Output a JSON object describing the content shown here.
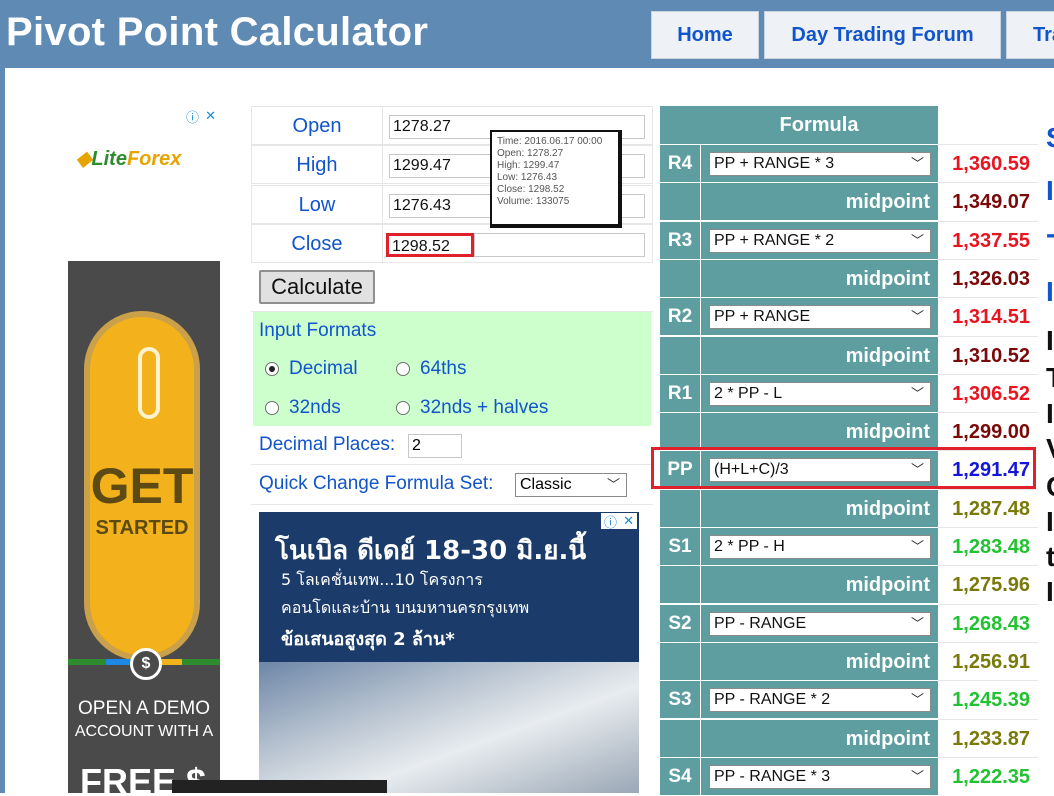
{
  "header": {
    "title": "Pivot Point Calculator",
    "nav": [
      "Home",
      "Day Trading Forum",
      "Tra"
    ]
  },
  "ads": {
    "left": {
      "logo": [
        "Lite",
        "Forex"
      ],
      "cta_big": "GET",
      "cta_small": "STARTED",
      "demo_line1": "OPEN A DEMO",
      "demo_line2": "ACCOUNT WITH A",
      "free": "FREE $"
    },
    "mid": {
      "line1": "โนเบิล ดีเดย์ 18-30 มิ.ย.นี้",
      "line2": "5 โลเคชั่นเทพ...10 โครงการ",
      "line3": "คอนโดและบ้าน บนมหานครกรุงเทพ",
      "line4": "ข้อเสนอสูงสุด 2 ล้าน*"
    }
  },
  "inputs": {
    "open": {
      "label": "Open",
      "value": "1278.27"
    },
    "high": {
      "label": "High",
      "value": "1299.47"
    },
    "low": {
      "label": "Low",
      "value": "1276.43"
    },
    "close": {
      "label": "Close",
      "value": "1298.52"
    },
    "calculate": "Calculate"
  },
  "tooltip": {
    "time": "Time: 2016.06.17 00:00",
    "open": "Open: 1278.27",
    "high": "High: 1299.47",
    "low": "Low:  1276.43",
    "close": "Close: 1298.52",
    "volume": "Volume: 133075"
  },
  "formats": {
    "title": "Input Formats",
    "options": [
      "Decimal",
      "64ths",
      "32nds",
      "32nds + halves"
    ],
    "selected": "Decimal"
  },
  "decimal_places": {
    "label": "Decimal Places:",
    "value": "2"
  },
  "quick_change": {
    "label": "Quick Change Formula Set:",
    "value": "Classic"
  },
  "pivot": {
    "header": "Formula",
    "midpoint_label": "midpoint",
    "rows": [
      {
        "label": "R4",
        "formula": "PP + RANGE * 3",
        "value": "1,360.59",
        "color": "#e8141f"
      },
      {
        "mid": "1,349.07",
        "color": "#7a0a0a"
      },
      {
        "label": "R3",
        "formula": "PP + RANGE * 2",
        "value": "1,337.55",
        "color": "#e8141f"
      },
      {
        "mid": "1,326.03",
        "color": "#7a0a0a"
      },
      {
        "label": "R2",
        "formula": "PP + RANGE",
        "value": "1,314.51",
        "color": "#e8141f"
      },
      {
        "mid": "1,310.52",
        "color": "#7a0a0a"
      },
      {
        "label": "R1",
        "formula": "2 * PP - L",
        "value": "1,306.52",
        "color": "#e8141f"
      },
      {
        "mid": "1,299.00",
        "color": "#7a0a0a"
      },
      {
        "label": "PP",
        "formula": "(H+L+C)/3",
        "value": "1,291.47",
        "color": "#1616d8"
      },
      {
        "mid": "1,287.48",
        "color": "#7a7a0a"
      },
      {
        "label": "S1",
        "formula": "2 * PP - H",
        "value": "1,283.48",
        "color": "#22c232"
      },
      {
        "mid": "1,275.96",
        "color": "#7a7a0a"
      },
      {
        "label": "S2",
        "formula": "PP - RANGE",
        "value": "1,268.43",
        "color": "#22c232"
      },
      {
        "mid": "1,256.91",
        "color": "#7a7a0a"
      },
      {
        "label": "S3",
        "formula": "PP - RANGE * 2",
        "value": "1,245.39",
        "color": "#22c232"
      },
      {
        "mid": "1,233.87",
        "color": "#7a7a0a"
      },
      {
        "label": "S4",
        "formula": "PP - RANGE * 3",
        "value": "1,222.35",
        "color": "#22c232"
      }
    ]
  },
  "right_cut": [
    "S",
    "I",
    "-",
    "I",
    "I",
    "T",
    "I",
    "V",
    "C",
    "I",
    "t",
    "I"
  ]
}
